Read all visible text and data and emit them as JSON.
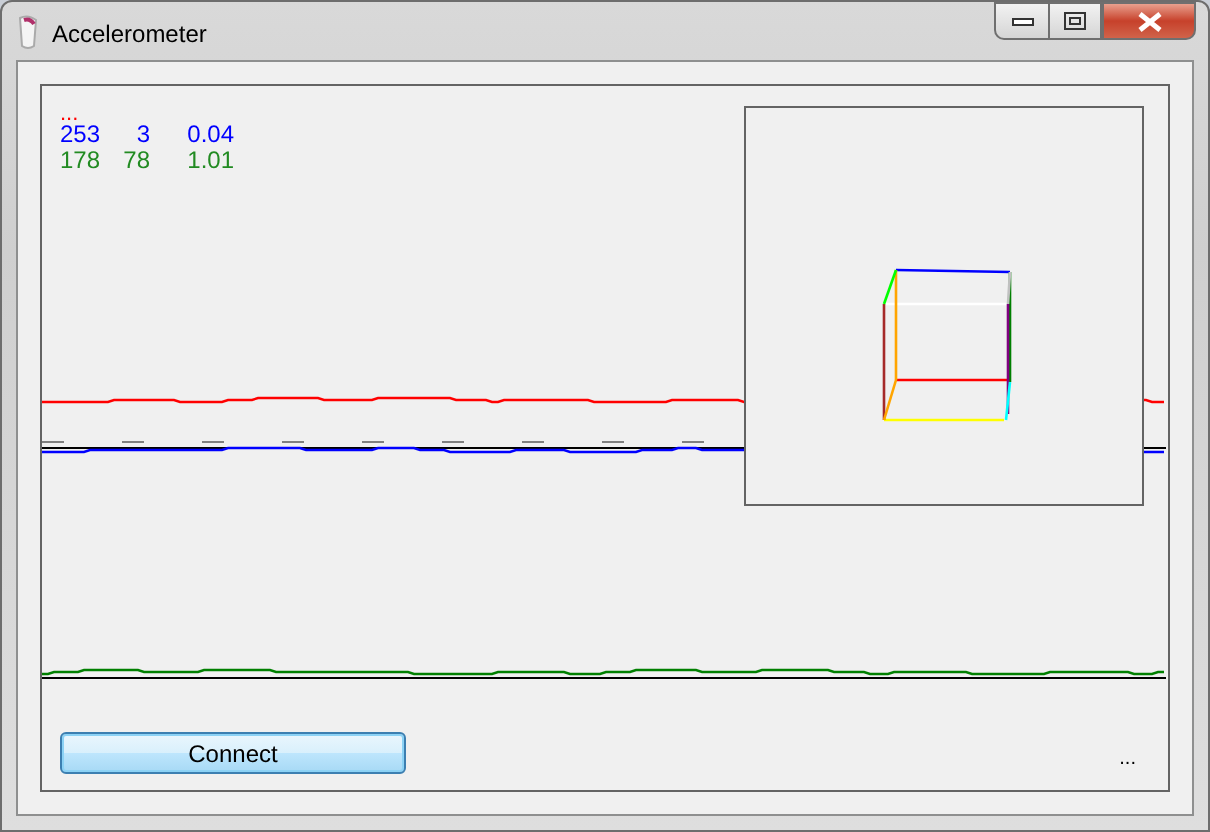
{
  "window": {
    "title": "Accelerometer"
  },
  "status_top": "...",
  "readings": [
    {
      "values": [
        "253",
        "3",
        "0.04"
      ],
      "color": "#0000ff"
    },
    {
      "values": [
        "178",
        "78",
        "1.01"
      ],
      "color": "#228b22"
    }
  ],
  "button": "Connect",
  "status_bottom": "..."
}
